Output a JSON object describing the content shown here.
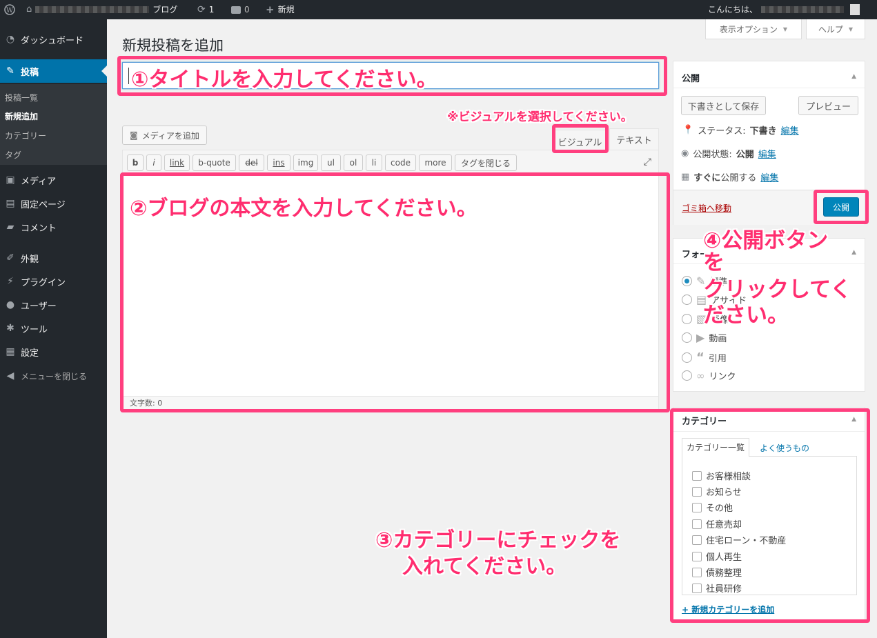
{
  "adminbar": {
    "site_suffix": "ブログ",
    "updates_count": "1",
    "comments_count": "0",
    "new_label": "新規",
    "greeting": "こんにちは、"
  },
  "sidebar": {
    "dashboard": "ダッシュボード",
    "posts": "投稿",
    "sub_all": "投稿一覧",
    "sub_new": "新規追加",
    "sub_category": "カテゴリー",
    "sub_tag": "タグ",
    "media": "メディア",
    "pages": "固定ページ",
    "comments": "コメント",
    "appearance": "外観",
    "plugins": "プラグイン",
    "users": "ユーザー",
    "tools": "ツール",
    "settings": "設定",
    "collapse": "メニューを閉じる"
  },
  "header": {
    "screen_options": "表示オプション",
    "help": "ヘルプ",
    "page_title": "新規投稿を追加"
  },
  "editor": {
    "add_media": "メディアを追加",
    "tab_visual": "ビジュアル",
    "tab_text": "テキスト",
    "quicktags": [
      "b",
      "i",
      "link",
      "b-quote",
      "del",
      "ins",
      "img",
      "ul",
      "ol",
      "li",
      "code",
      "more",
      "タグを閉じる"
    ],
    "word_count": "文字数: 0"
  },
  "publish": {
    "title": "公開",
    "save_draft": "下書きとして保存",
    "preview": "プレビュー",
    "status_label": "ステータス:",
    "status_value": "下書き",
    "visibility_label": "公開状態:",
    "visibility_value": "公開",
    "schedule_bold": "すぐに",
    "schedule_rest": "公開する",
    "edit": "編集",
    "trash": "ゴミ箱へ移動",
    "publish_button": "公開"
  },
  "format": {
    "title_partial": "フォー",
    "items": [
      "標準",
      "アサイド",
      "画像",
      "動画",
      "引用",
      "リンク"
    ]
  },
  "categories": {
    "title": "カテゴリー",
    "tab_all": "カテゴリー一覧",
    "tab_popular": "よく使うもの",
    "items": [
      "お客様相談",
      "お知らせ",
      "その他",
      "任意売却",
      "住宅ローン・不動産",
      "個人再生",
      "債務整理",
      "社員研修"
    ],
    "add_new": "+ 新規カテゴリーを追加"
  },
  "annotations": {
    "a1": "①タイトルを入力してください。",
    "a_visual": "※ビジュアルを選択してください。",
    "a2": "②ブログの本文を入力してください。",
    "a3_line1": "③カテゴリーにチェックを",
    "a3_line2": "入れてください。",
    "a4_line1": "④公開ボタン",
    "a4_line2": "を",
    "a4_line3": "クリックしてく",
    "a4_line4": "ださい。"
  },
  "colors": {
    "admin_dark": "#23282d",
    "accent_blue": "#0073aa",
    "publish_blue": "#0085ba",
    "annotation_pink": "#ff3f7f",
    "trash_red": "#a00"
  }
}
